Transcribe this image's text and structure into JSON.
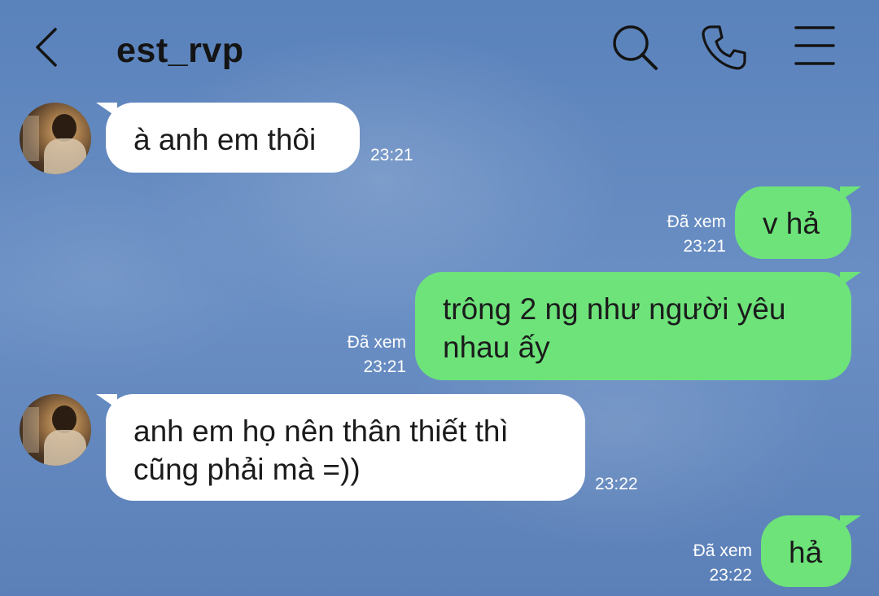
{
  "header": {
    "title": "est_rvp",
    "back_icon": "chevron-left-icon",
    "search_icon": "search-icon",
    "call_icon": "phone-icon",
    "menu_icon": "menu-icon"
  },
  "theme": {
    "outgoing_bubble_color": "#6de37a",
    "incoming_bubble_color": "#ffffff",
    "background_color": "#6187bd"
  },
  "messages": [
    {
      "direction": "incoming",
      "text": "à anh em thôi",
      "time": "23:21"
    },
    {
      "direction": "outgoing",
      "text": "v hả",
      "status": "Đã xem",
      "time": "23:21"
    },
    {
      "direction": "outgoing",
      "text": "trông 2 ng như người yêu\nnhau ấy",
      "status": "Đã xem",
      "time": "23:21"
    },
    {
      "direction": "incoming",
      "text": "anh em họ nên thân thiết thì\ncũng phải mà =))",
      "time": "23:22"
    },
    {
      "direction": "outgoing",
      "text": "hả",
      "status": "Đã xem",
      "time": "23:22"
    }
  ]
}
